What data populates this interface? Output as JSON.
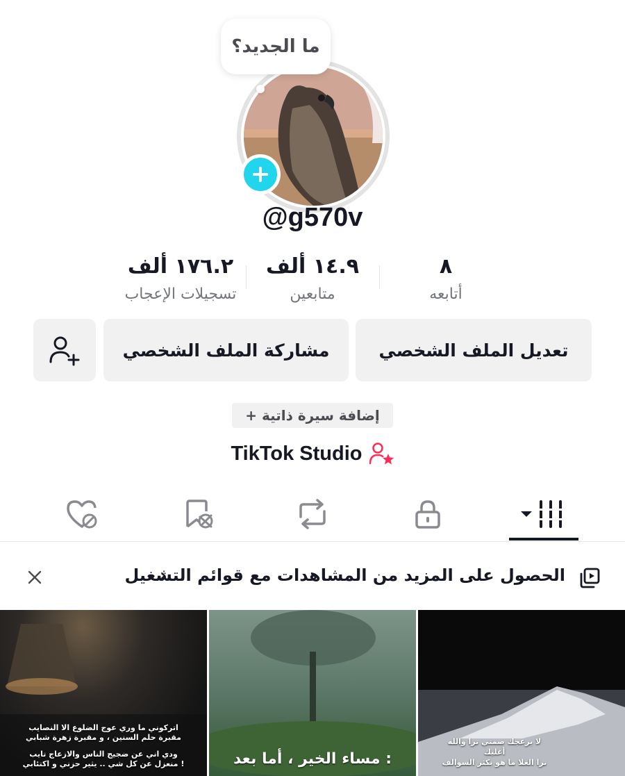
{
  "profile": {
    "bubble_text": "ما الجديد؟",
    "username": "@g570v"
  },
  "stats": {
    "likes": {
      "value": "١٧٦.٢ ألف",
      "label": "تسجيلات الإعجاب"
    },
    "followers": {
      "value": "١٤.٩ ألف",
      "label": "متابعين"
    },
    "following": {
      "value": "٨",
      "label": "أتابعه"
    }
  },
  "actions": {
    "edit_profile": "تعديل الملف الشخصي",
    "share_profile": "مشاركة الملف الشخصي"
  },
  "bio": {
    "add_bio": "+ إضافة سيرة ذاتية"
  },
  "studio": {
    "label": "TikTok Studio"
  },
  "tabs": [
    {
      "icon": "videos-grid-icon"
    },
    {
      "icon": "lock-icon"
    },
    {
      "icon": "repost-icon"
    },
    {
      "icon": "saved-icon"
    },
    {
      "icon": "liked-icon"
    }
  ],
  "playlist_banner": {
    "text": "الحصول على المزيد من المشاهدات مع قوائم التشغيل",
    "chevron": "›"
  },
  "videos": [
    {
      "caption_line1": "اتركوني ما وري عوج الضلوع الا النصايب",
      "caption_line2": "مقبرة حلم السنين ، و مقبرة زهرة شبابي",
      "caption_line3": "ودي اني عن ضجيج الناس والازعاج تايب",
      "caption_line4": "منعزل عن كل شي .. يثير حزني و اكتئابي !"
    },
    {
      "caption_line1": "مساء الخير ، أما بعد :"
    },
    {
      "caption_line1": "لا يزعجك صمتي ترا والله أغليك",
      "caption_line2": "ترا الغلا ما هو بكثر السوالف"
    }
  ],
  "colors": {
    "accent": "#20d5ec",
    "studio_icon": "#fe2c55"
  }
}
